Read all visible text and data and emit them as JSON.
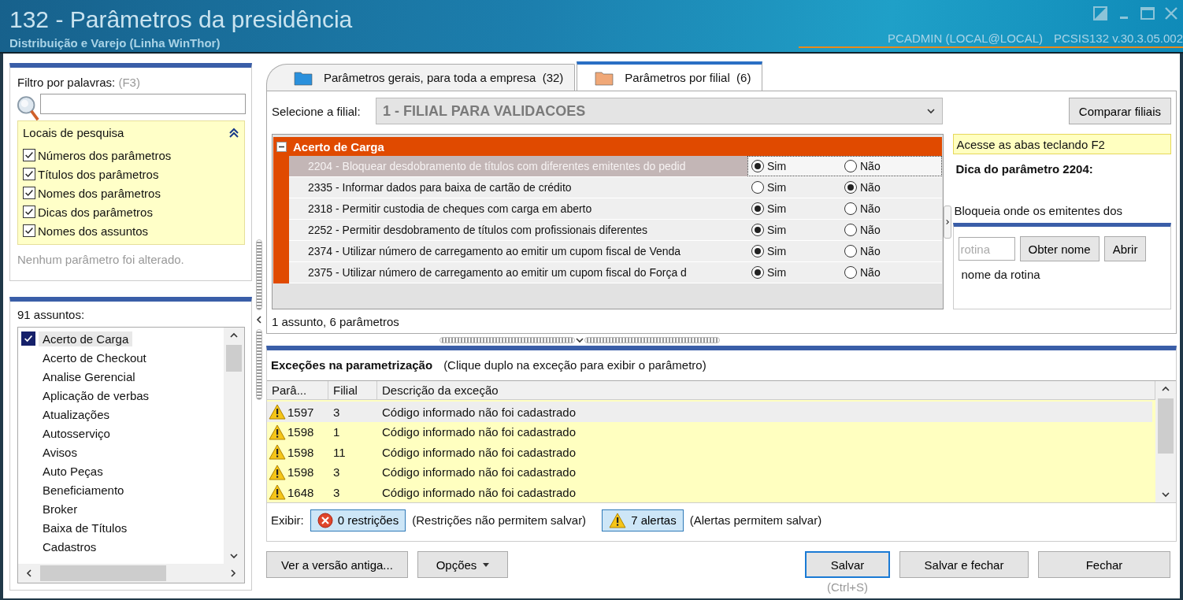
{
  "window": {
    "title": "132 - Parâmetros da presidência",
    "subtitle": "Distribuição e Varejo (Linha WinThor)",
    "user": "PCADMIN (LOCAL@LOCAL)",
    "version": "PCSIS132  v.30.3.05.002"
  },
  "filter": {
    "label": "Filtro por palavras:",
    "shortcut": "(F3)",
    "search_locations": {
      "title": "Locais de pesquisa",
      "expanded": true,
      "items": [
        {
          "label": "Números dos parâmetros",
          "checked": true
        },
        {
          "label": "Títulos dos parâmetros",
          "checked": true
        },
        {
          "label": "Nomes dos parâmetros",
          "checked": true
        },
        {
          "label": "Dicas dos parâmetros",
          "checked": true
        },
        {
          "label": "Nomes dos assuntos",
          "checked": true
        }
      ]
    },
    "status": "Nenhum parâmetro foi alterado."
  },
  "subjects": {
    "count_label": "91 assuntos:",
    "items": [
      {
        "label": "Acerto de Carga",
        "checked": true,
        "selected": true
      },
      {
        "label": "Acerto de Checkout",
        "checked": false,
        "selected": false
      },
      {
        "label": "Analise Gerencial",
        "checked": false,
        "selected": false
      },
      {
        "label": "Aplicação de verbas",
        "checked": false,
        "selected": false
      },
      {
        "label": "Atualizações",
        "checked": false,
        "selected": false
      },
      {
        "label": "Autosserviço",
        "checked": false,
        "selected": false
      },
      {
        "label": "Avisos",
        "checked": false,
        "selected": false
      },
      {
        "label": "Auto Peças",
        "checked": false,
        "selected": false
      },
      {
        "label": "Beneficiamento",
        "checked": false,
        "selected": false
      },
      {
        "label": "Broker",
        "checked": false,
        "selected": false
      },
      {
        "label": "Baixa de Títulos",
        "checked": false,
        "selected": false
      },
      {
        "label": "Cadastros",
        "checked": false,
        "selected": false
      }
    ]
  },
  "tabs": [
    {
      "label": "Parâmetros gerais, para toda a empresa",
      "count": "(32)",
      "selected": false,
      "color": "#2a90dc"
    },
    {
      "label": "Parâmetros por filial",
      "count": "(6)",
      "selected": true,
      "color": "#f0a878"
    }
  ],
  "branch": {
    "label": "Selecione a filial:",
    "value": "1 - FILIAL PARA VALIDACOES",
    "disabled": true
  },
  "compare_button": "Comparar filiais",
  "group": {
    "title": "Acerto de Carga",
    "expanded": true,
    "params": [
      {
        "title": "2204 - Bloquear desdobramento de títulos com diferentes emitentes do pedid",
        "selected": true,
        "options": [
          {
            "label": "Sim",
            "selected": true
          },
          {
            "label": "Não",
            "selected": false
          }
        ]
      },
      {
        "title": "2335 - Informar dados para baixa de cartão de crédito",
        "selected": false,
        "options": [
          {
            "label": "Sim",
            "selected": false
          },
          {
            "label": "Não",
            "selected": true
          }
        ]
      },
      {
        "title": "2318 - Permitir custodia de cheques com carga em aberto",
        "selected": false,
        "options": [
          {
            "label": "Sim",
            "selected": true
          },
          {
            "label": "Não",
            "selected": false
          }
        ]
      },
      {
        "title": "2252 - Permitir desdobramento de títulos com profissionais diferentes",
        "selected": false,
        "options": [
          {
            "label": "Sim",
            "selected": true
          },
          {
            "label": "Não",
            "selected": false
          }
        ]
      },
      {
        "title": "2374 - Utilizar número de carregamento ao emitir um cupom fiscal de Venda",
        "selected": false,
        "options": [
          {
            "label": "Sim",
            "selected": true
          },
          {
            "label": "Não",
            "selected": false
          }
        ]
      },
      {
        "title": "2375 - Utilizar número de carregamento ao emitir um cupom fiscal do Força d",
        "selected": false,
        "options": [
          {
            "label": "Sim",
            "selected": true
          },
          {
            "label": "Não",
            "selected": false
          }
        ]
      }
    ]
  },
  "summary": "1 assunto, 6 parâmetros",
  "tip": {
    "hint": "Acesse as abas teclando F2",
    "heading": "Dica do parâmetro 2204:",
    "text": "Bloqueia onde os emitentes dos"
  },
  "routine": {
    "placeholder": "rotina",
    "buttons": [
      "Obter nome",
      "Abrir"
    ],
    "name": "nome da rotina"
  },
  "exceptions": {
    "title": "Exceções na parametrização",
    "note": "(Clique duplo na exceção para exibir o parâmetro)",
    "columns": [
      "Parâ...",
      "Filial",
      "Descrição da exceção"
    ],
    "rows": [
      {
        "param": "1597",
        "branch": "3",
        "description": "Código informado não foi cadastrado",
        "selected": true
      },
      {
        "param": "1598",
        "branch": "1",
        "description": "Código informado não foi cadastrado",
        "selected": false
      },
      {
        "param": "1598",
        "branch": "11",
        "description": "Código informado não foi cadastrado",
        "selected": false
      },
      {
        "param": "1598",
        "branch": "3",
        "description": "Código informado não foi cadastrado",
        "selected": false
      },
      {
        "param": "1648",
        "branch": "3",
        "description": "Código informado não foi cadastrado",
        "selected": false
      }
    ],
    "show_label": "Exibir:",
    "filters": [
      {
        "kind": "error",
        "label": "0 restrições",
        "note": "(Restrições não permitem salvar)"
      },
      {
        "kind": "warning",
        "label": "7 alertas",
        "note": "(Alertas permitem salvar)"
      }
    ]
  },
  "actions": {
    "left": [
      {
        "label": "Ver a versão antiga...",
        "dropdown": false
      },
      {
        "label": "Opções",
        "dropdown": true
      }
    ],
    "right": [
      {
        "label": "Salvar",
        "default": true,
        "hint": "(Ctrl+S)"
      },
      {
        "label": "Salvar e fechar",
        "default": false
      },
      {
        "label": "Fechar",
        "default": false
      }
    ]
  }
}
